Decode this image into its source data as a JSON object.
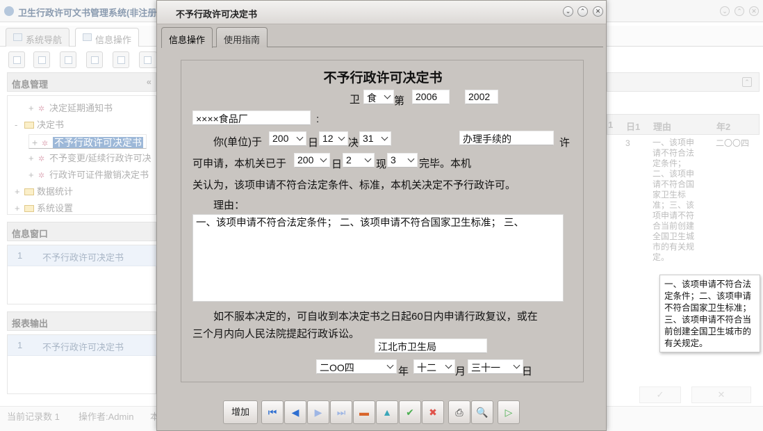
{
  "app": {
    "title": "卫生行政许可文书管理系统(非注册",
    "tabs": [
      "系统导航",
      "信息操作"
    ],
    "left": {
      "info_mgmt_title": "信息管理",
      "collapse_glyph": "«",
      "tree": [
        {
          "label": "决定延期通知书",
          "prefix": "+"
        },
        {
          "label": "决定书",
          "prefix": "-"
        },
        {
          "label": "不予行政许可决定书",
          "prefix": "+"
        },
        {
          "label": "不予变更/延续行政许可决",
          "prefix": "+"
        },
        {
          "label": "行政许可证件撤销决定书",
          "prefix": "+"
        },
        {
          "label": "数据统计",
          "prefix": "+"
        },
        {
          "label": "系统设置",
          "prefix": "+"
        }
      ],
      "info_window_title": "信息窗口",
      "info_window_row": {
        "num": "1",
        "value": "不予行政许可决定书"
      },
      "report_title": "报表输出",
      "report_row": {
        "num": "1",
        "value": "不予行政许可决定书"
      }
    },
    "status": {
      "records": "当前记录数 1",
      "operator": "操作者:Admin",
      "extra": "本"
    },
    "right": {
      "headers": [
        "日1",
        "理由",
        "年2"
      ],
      "header_prefix": "1",
      "row_day": "3",
      "row_reason": "一、该项申请不符合法定条件；二、该项申请不符合国家卫生标准；三、该项申请不符合当前创建全国卫生城市的有关规定。",
      "row_year": "二〇〇四",
      "bottom_buttons": [
        "✓",
        "✕"
      ]
    },
    "tooltip": "一、该项申请不符合法定条件；二、该项申请不符合国家卫生标准；三、该项申请不符合当前创建全国卫生城市的有关规定。"
  },
  "dialog": {
    "title": "不予行政许可决定书",
    "tabs": [
      "信息操作",
      "使用指南"
    ],
    "form": {
      "heading": "不予行政许可决定书",
      "wei": "卫",
      "category": "食",
      "di": "第",
      "year_no": "2006",
      "serial_no": "2002",
      "applicant": "××××食品厂",
      "colon": ":",
      "line1_prefix": "你(单位)于",
      "apply_year": "200",
      "ri": "日",
      "apply_month": "12",
      "jue": "决",
      "apply_day": "31",
      "item_name": "办理手续的",
      "xu": "许",
      "line2_prefix": "可申请，本机关已于",
      "review_year": "200",
      "ri2": "日",
      "review_month": "2",
      "xian": "现",
      "review_day": "3",
      "line2_suffix": "完毕。本机",
      "line3": "关认为，该项申请不符合法定条件、标准，本机关决定不予行政许可。",
      "reason_label": "理由：",
      "reason_text": "一、该项申请不符合法定条件；  二、该项申请不符合国家卫生标准；  三、",
      "appeal_line1": "如不服本决定的，可自收到本决定书之日起60日内申请行政复议，或在",
      "appeal_line2": "三个月内向人民法院提起行政诉讼。",
      "authority": "江北市卫生局",
      "date_year": "二OO四",
      "nian": "年",
      "date_month": "十二",
      "yue": "月",
      "date_day": "三十一",
      "ri3": "日"
    },
    "toolbar": {
      "add_label": "增加"
    }
  },
  "colors": {
    "dialog_bg": "#c9c5c1",
    "selection": "#9db8d8",
    "remove": "#d9652b",
    "confirm": "#4caf50",
    "cancel": "#e0524a",
    "nav": "#2f6fd1"
  }
}
